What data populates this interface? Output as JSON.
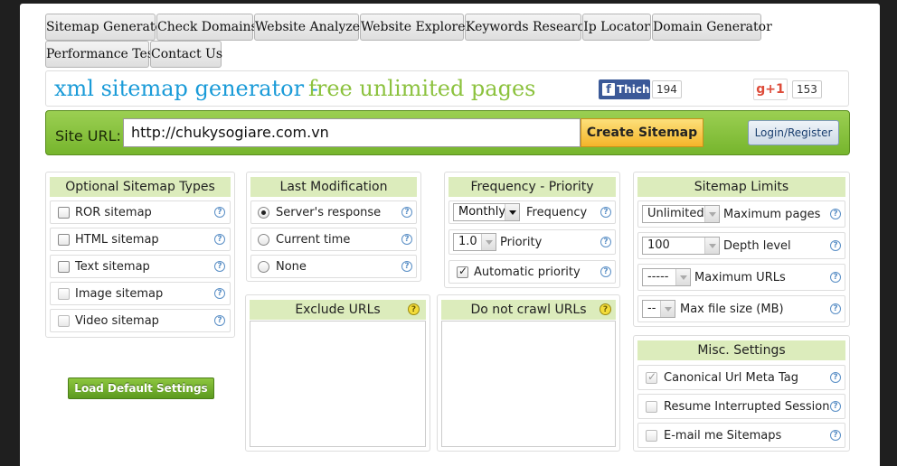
{
  "nav": {
    "tabs": [
      "Sitemap Generator",
      "Check Domains",
      "Website Analyzer",
      "Website Explorer",
      "Keywords Research",
      "Ip Locator",
      "Domain Generator",
      "Performance Test",
      "Contact Us"
    ]
  },
  "header": {
    "title_part1": "xml sitemap generator -",
    "title_part2": "free unlimited pages",
    "fb_label": "Thich",
    "fb_count": "194",
    "gplus_label": "g+1",
    "gplus_count": "153",
    "colors": {
      "title_blue": "#1a9bd8",
      "title_green": "#8cc23e",
      "facebook": "#3b5998"
    }
  },
  "urlbar": {
    "label": "Site URL:",
    "value": "http://chukysogiare.com.vn",
    "create_button": "Create Sitemap",
    "login_button": "Login/Register"
  },
  "sitemap_types": {
    "title": "Optional Sitemap Types",
    "items": [
      {
        "label": "ROR sitemap",
        "checked": false
      },
      {
        "label": "HTML sitemap",
        "checked": false
      },
      {
        "label": "Text sitemap",
        "checked": false
      },
      {
        "label": "Image sitemap",
        "checked": false
      },
      {
        "label": "Video sitemap",
        "checked": false
      }
    ],
    "load_defaults": "Load Default Settings"
  },
  "last_modification": {
    "title": "Last Modification",
    "options": [
      {
        "label": "Server's response",
        "selected": true
      },
      {
        "label": "Current time",
        "selected": false
      },
      {
        "label": "None",
        "selected": false
      }
    ]
  },
  "frequency": {
    "title": "Frequency - Priority",
    "frequency_value": "Monthly",
    "frequency_label": "Frequency",
    "priority_value": "1.0",
    "priority_label": "Priority",
    "auto_priority_label": "Automatic priority",
    "auto_priority_checked": true
  },
  "limits": {
    "title": "Sitemap Limits",
    "rows": [
      {
        "value": "Unlimited",
        "label": "Maximum pages"
      },
      {
        "value": "100",
        "label": "Depth level"
      },
      {
        "value": "-----",
        "label": "Maximum URLs"
      },
      {
        "value": "--",
        "label": "Max file size (MB)"
      }
    ]
  },
  "exclude": {
    "title": "Exclude URLs"
  },
  "nocrawl": {
    "title": "Do not crawl URLs"
  },
  "misc": {
    "title": "Misc. Settings",
    "items": [
      {
        "label": "Canonical Url Meta Tag",
        "checked": true
      },
      {
        "label": "Resume Interrupted Session",
        "checked": false
      },
      {
        "label": "E-mail me Sitemaps",
        "checked": false
      }
    ]
  },
  "help_glyph": "?"
}
